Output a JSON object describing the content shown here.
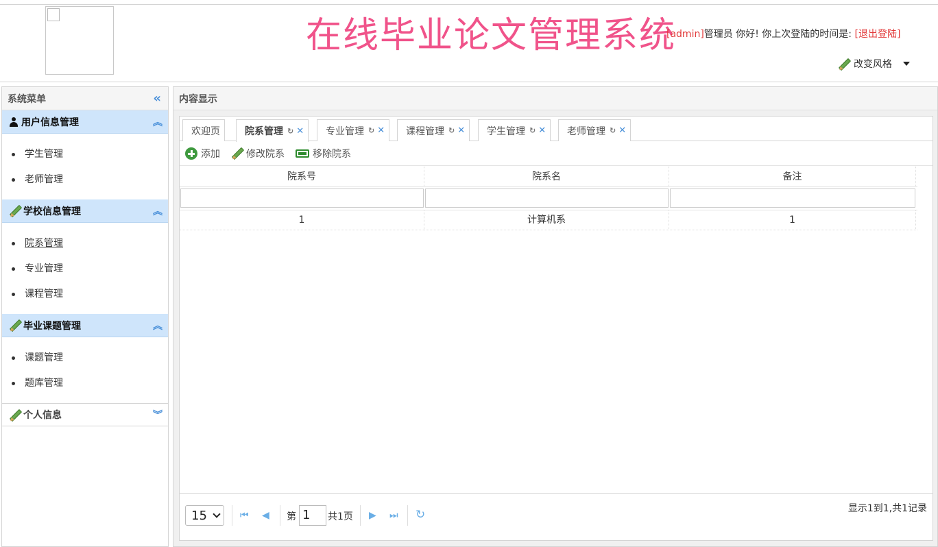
{
  "header": {
    "title": "在线毕业论文管理系统",
    "admin": "[admin]",
    "greeting": "管理员 你好! 你上次登陆的时间是:",
    "logout": "[退出登陆]",
    "theme_label": "改变风格"
  },
  "sidebar": {
    "title": "系统菜单",
    "groups": [
      {
        "title": "用户信息管理",
        "items": [
          "学生管理",
          "老师管理"
        ]
      },
      {
        "title": "学校信息管理",
        "items": [
          "院系管理",
          "专业管理",
          "课程管理"
        ]
      },
      {
        "title": "毕业课题管理",
        "items": [
          "课题管理",
          "题库管理"
        ]
      },
      {
        "title": "个人信息"
      }
    ]
  },
  "main": {
    "title": "内容显示",
    "tabs": [
      "欢迎页",
      "院系管理",
      "专业管理",
      "课程管理",
      "学生管理",
      "老师管理"
    ],
    "active_tab": "院系管理",
    "toolbar": {
      "add": "添加",
      "edit": "修改院系",
      "remove": "移除院系"
    },
    "grid": {
      "columns": [
        "院系号",
        "院系名",
        "备注"
      ],
      "rows": [
        [
          "1",
          "计算机系",
          "1"
        ]
      ]
    },
    "pager": {
      "page_size": "15",
      "page_prefix": "第",
      "page": "1",
      "total_pages": "共1页",
      "info": "显示1到1,共1记录"
    }
  }
}
